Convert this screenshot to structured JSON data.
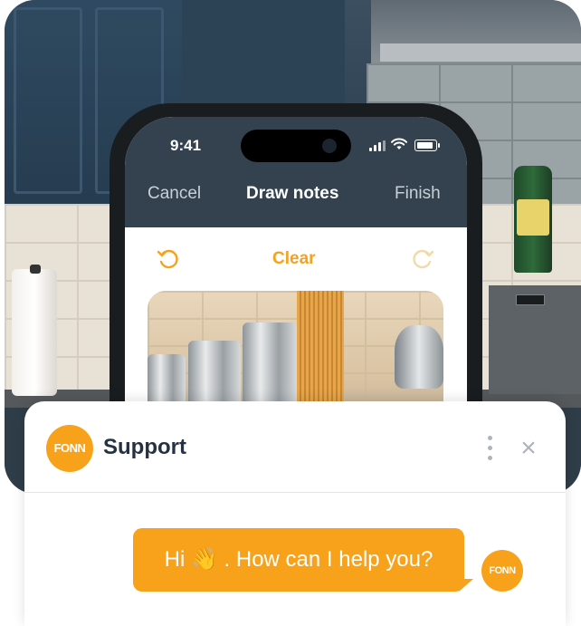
{
  "phone": {
    "status_time": "9:41",
    "nav": {
      "cancel": "Cancel",
      "title": "Draw notes",
      "finish": "Finish"
    },
    "toolbar": {
      "clear": "Clear",
      "undo_icon": "undo-icon",
      "redo_icon": "redo-icon"
    }
  },
  "chat": {
    "logo_text": "FONN",
    "title": "Support",
    "message": "Hi 👋 . How can I help you?",
    "avatar_text": "FONN"
  },
  "colors": {
    "accent": "#f7a21a",
    "header_dark": "#344250",
    "text_dark": "#263241"
  }
}
